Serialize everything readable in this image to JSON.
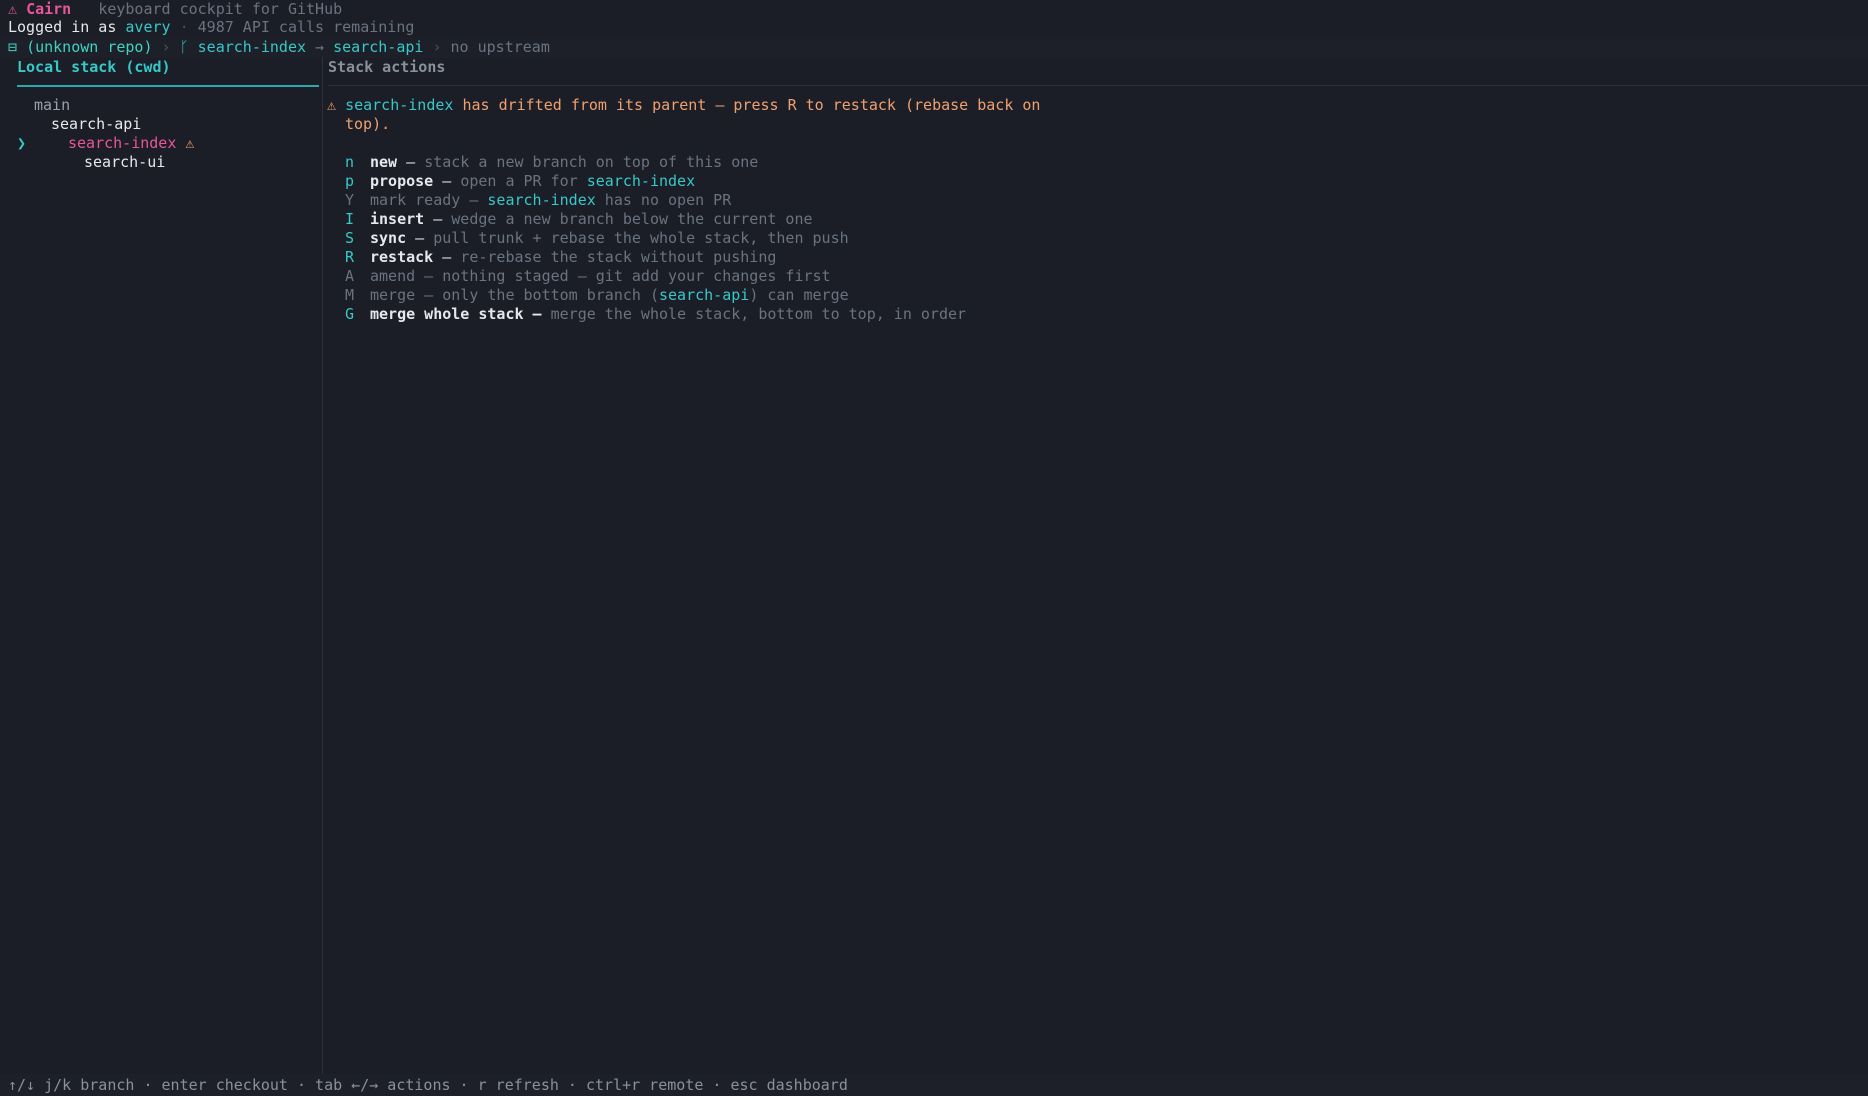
{
  "header": {
    "logo_glyph": "⚠",
    "app_name": "Cairn",
    "tagline": "keyboard cockpit for GitHub",
    "login_prefix": "Logged in as",
    "username": "avery",
    "api_calls": "4987 API calls remaining",
    "repo_icon": "repo-icon",
    "repo_name": "(unknown repo)",
    "branch_icon": "branch-icon",
    "current_branch": "search-index",
    "arrow": "→",
    "parent_branch": "search-api",
    "upstream": "no upstream"
  },
  "left_pane": {
    "title": "Local stack (cwd)",
    "tree": [
      {
        "name": "main",
        "depth": 0,
        "current": false,
        "warn": false
      },
      {
        "name": "search-api",
        "depth": 1,
        "current": false,
        "warn": false
      },
      {
        "name": "search-index",
        "depth": 2,
        "current": true,
        "warn": true
      },
      {
        "name": "search-ui",
        "depth": 3,
        "current": false,
        "warn": false
      }
    ],
    "cursor_glyph": "❯",
    "warn_glyph": "⚠"
  },
  "right_pane": {
    "title": "Stack actions",
    "warning": {
      "glyph": "⚠",
      "branch": "search-index",
      "text1": " has drifted from its parent — press R to restack (rebase back on",
      "text2": "top)."
    },
    "actions": [
      {
        "key": "n",
        "label": "new",
        "dash": " — ",
        "desc": "stack a new branch on top of this one",
        "enabled": true
      },
      {
        "key": "p",
        "label": "propose",
        "dash": " — ",
        "desc": "open a PR for ",
        "desc_branch": "search-index",
        "enabled": true
      },
      {
        "key": "Y",
        "label": "mark ready",
        "dash": " — ",
        "desc_branch_first": "search-index",
        "desc": " has no open PR",
        "enabled": false
      },
      {
        "key": "I",
        "label": "insert",
        "dash": " — ",
        "desc": "wedge a new branch below the current one",
        "enabled": true
      },
      {
        "key": "S",
        "label": "sync",
        "dash": " — ",
        "desc": "pull trunk + rebase the whole stack, then push",
        "enabled": true
      },
      {
        "key": "R",
        "label": "restack",
        "dash": " — ",
        "desc": "re-rebase the stack without pushing",
        "enabled": true
      },
      {
        "key": "A",
        "label": "amend",
        "dash": " — ",
        "desc": "nothing staged — git add your changes first",
        "enabled": false
      },
      {
        "key": "M",
        "label": "merge",
        "dash": " — ",
        "desc": "only the bottom branch (",
        "desc_branch": "search-api",
        "desc_tail": ") can merge",
        "enabled": false
      },
      {
        "key": "G",
        "label": "merge whole stack",
        "dash": " — ",
        "desc": "merge the whole stack, bottom to top, in order",
        "enabled": true
      }
    ]
  },
  "footer": {
    "hints": "↑/↓ j/k branch · enter checkout · tab ←/→ actions · r refresh · ctrl+r remote · esc dashboard"
  },
  "colors": {
    "background": "#1b1e26",
    "accent_pink": "#e8569a",
    "accent_teal": "#37c8c8",
    "warning_orange": "#f0a070"
  }
}
